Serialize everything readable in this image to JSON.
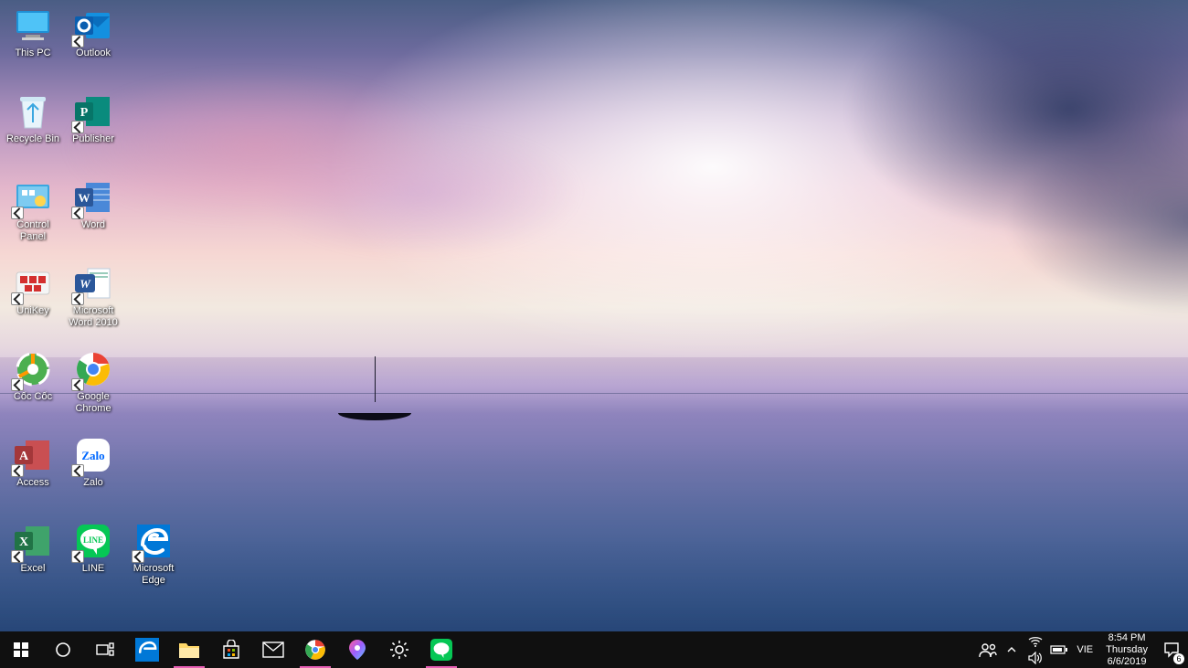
{
  "desktop": {
    "icons": [
      {
        "id": "this-pc",
        "label": "This PC",
        "shortcut": false,
        "col": 1,
        "row": 1
      },
      {
        "id": "outlook",
        "label": "Outlook",
        "shortcut": true,
        "col": 2,
        "row": 1
      },
      {
        "id": "recycle-bin",
        "label": "Recycle Bin",
        "shortcut": false,
        "col": 1,
        "row": 2
      },
      {
        "id": "publisher",
        "label": "Publisher",
        "shortcut": true,
        "col": 2,
        "row": 2
      },
      {
        "id": "control-panel",
        "label": "Control Panel",
        "shortcut": true,
        "col": 1,
        "row": 3
      },
      {
        "id": "word",
        "label": "Word",
        "shortcut": true,
        "col": 2,
        "row": 3
      },
      {
        "id": "unikey",
        "label": "UniKey",
        "shortcut": true,
        "col": 1,
        "row": 4
      },
      {
        "id": "word-2010",
        "label": "Microsoft Word 2010",
        "shortcut": true,
        "col": 2,
        "row": 4
      },
      {
        "id": "coc-coc",
        "label": "Cốc Cốc",
        "shortcut": true,
        "col": 1,
        "row": 5
      },
      {
        "id": "chrome",
        "label": "Google Chrome",
        "shortcut": true,
        "col": 2,
        "row": 5
      },
      {
        "id": "access",
        "label": "Access",
        "shortcut": true,
        "col": 1,
        "row": 6
      },
      {
        "id": "zalo",
        "label": "Zalo",
        "shortcut": true,
        "col": 2,
        "row": 6
      },
      {
        "id": "excel",
        "label": "Excel",
        "shortcut": true,
        "col": 1,
        "row": 7
      },
      {
        "id": "line",
        "label": "LINE",
        "shortcut": true,
        "col": 2,
        "row": 7
      },
      {
        "id": "edge-legacy",
        "label": "Microsoft Edge",
        "shortcut": true,
        "col": 3,
        "row": 7
      }
    ]
  },
  "taskbar": {
    "start": "Start",
    "cortana": "Cortana",
    "taskview": "Task View",
    "apps": [
      {
        "id": "edge",
        "name": "Microsoft Edge",
        "running": false
      },
      {
        "id": "explorer",
        "name": "File Explorer",
        "running": true,
        "accent": "pink"
      },
      {
        "id": "store",
        "name": "Microsoft Store",
        "running": false
      },
      {
        "id": "mail",
        "name": "Mail",
        "running": false
      },
      {
        "id": "chrome",
        "name": "Google Chrome",
        "running": true,
        "accent": "pink"
      },
      {
        "id": "maps",
        "name": "Maps",
        "running": false
      },
      {
        "id": "settings",
        "name": "Settings",
        "running": false
      },
      {
        "id": "line",
        "name": "LINE",
        "running": true,
        "accent": "pink"
      }
    ]
  },
  "tray": {
    "people": "People",
    "chevron": "Show hidden icons",
    "wifi": "Network",
    "battery": "Battery",
    "volume": "Volume",
    "language": "VIE",
    "time": "8:54 PM",
    "day": "Thursday",
    "date": "6/6/2019",
    "notifications_count": "6"
  },
  "colors": {
    "outlook": "#0078D4",
    "publisher": "#077568",
    "word": "#2B579A",
    "word2010": "#2B579A",
    "chrome_red": "#EA4335",
    "chrome_yellow": "#FBBC05",
    "chrome_green": "#34A853",
    "chrome_blue": "#4285F4",
    "access": "#A4373A",
    "zalo": "#0068FF",
    "excel": "#217346",
    "line": "#06C755",
    "edge": "#0078D7",
    "coccoc": "#4CAF50",
    "unikey": "#D32F2F"
  }
}
